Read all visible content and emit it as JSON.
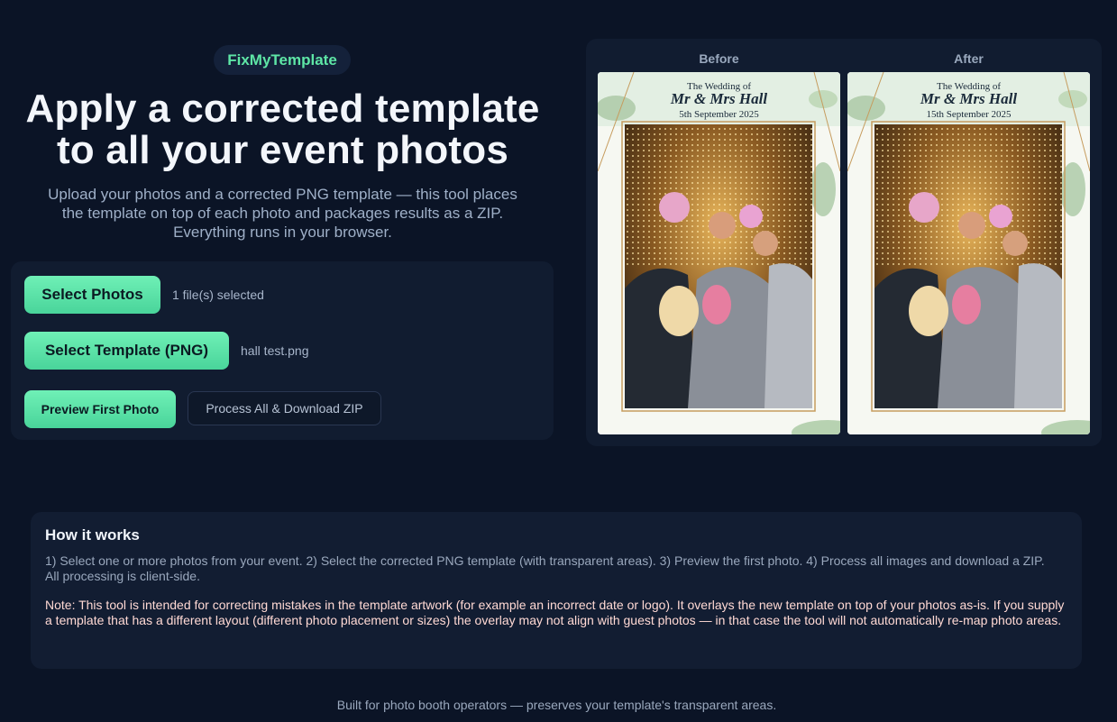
{
  "brand": {
    "name": "FixMyTemplate"
  },
  "hero": {
    "title_line1": "Apply a corrected template",
    "title_line2": "to all your event photos",
    "subtitle_line1": "Upload your photos and a corrected PNG template — this tool places",
    "subtitle_line2": "the template on top of each photo and packages results as a ZIP.",
    "subtitle_line3": "Everything runs in your browser."
  },
  "controls": {
    "select_photos_label": "Select Photos",
    "photos_status": "1 file(s) selected",
    "select_template_label": "Select Template (PNG)",
    "template_filename": "hall test.png",
    "preview_label": "Preview First Photo",
    "process_label": "Process All & Download ZIP"
  },
  "preview": {
    "before_label": "Before",
    "after_label": "After",
    "before_card": {
      "line1": "The Wedding of",
      "line2": "Mr & Mrs Hall",
      "line3": "5th September 2025"
    },
    "after_card": {
      "line1": "The Wedding of",
      "line2": "Mr & Mrs Hall",
      "line3": "15th September 2025"
    }
  },
  "how": {
    "title": "How it works",
    "steps": "1) Select one or more photos from your event. 2) Select the corrected PNG template (with transparent areas). 3) Preview the first photo. 4) Process all images and download a ZIP. All processing is client-side.",
    "note": "Note: This tool is intended for correcting mistakes in the template artwork (for example an incorrect date or logo). It overlays the new template on top of your photos as-is. If you supply a template that has a different layout (different photo placement or sizes) the overlay may not align with guest photos — in that case the tool will not automatically re-map photo areas."
  },
  "footer": {
    "text": "Built for photo booth operators — preserves your template's transparent areas."
  },
  "colors": {
    "background": "#0b1426",
    "accent": "#5ee6a6",
    "panel": "#111c30",
    "note": "#ffd9d4"
  }
}
